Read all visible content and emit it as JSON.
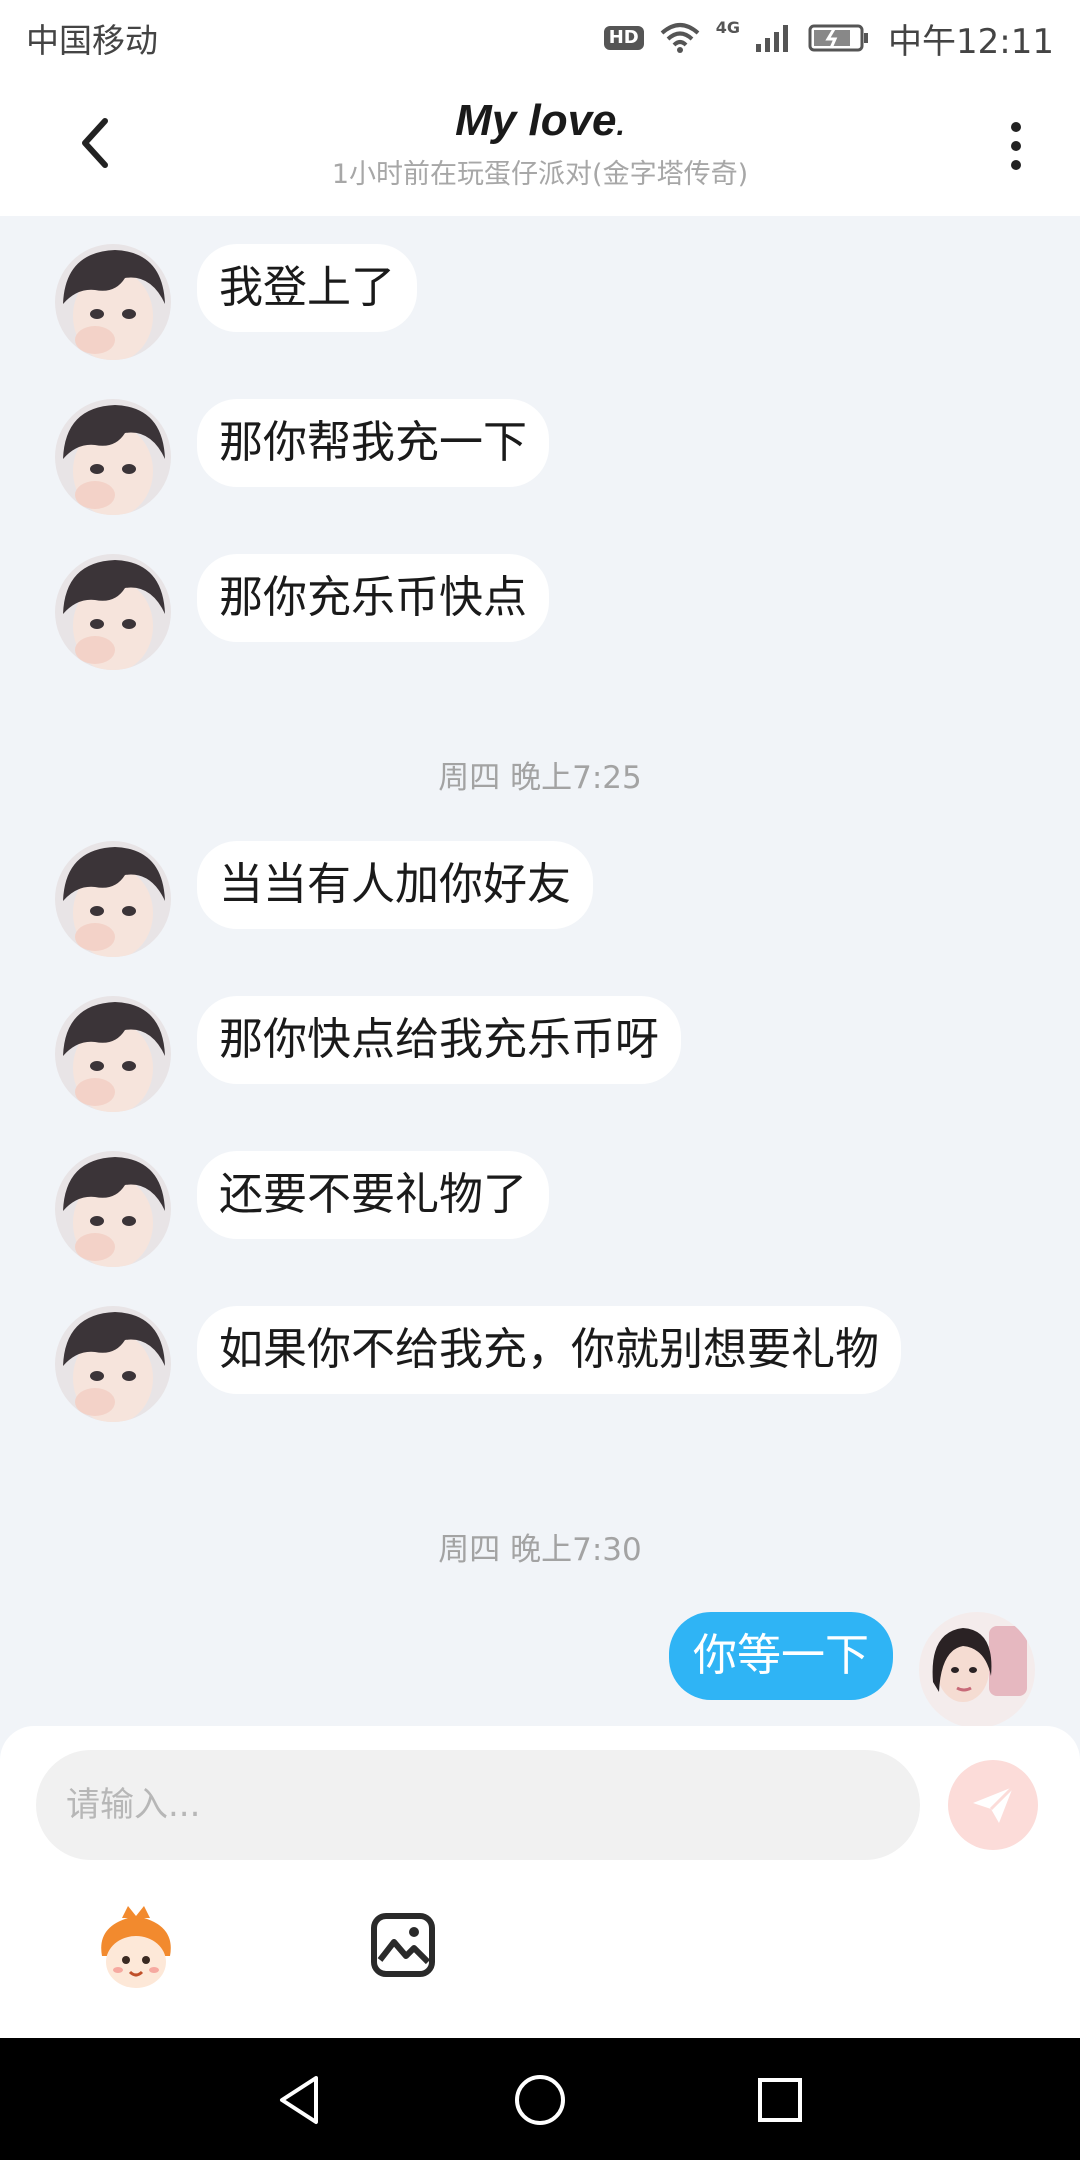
{
  "status_bar": {
    "carrier": "中国移动",
    "hd": "HD",
    "network": "4G",
    "time": "中午12:11"
  },
  "header": {
    "title": "My love",
    "title_dot": ".",
    "subtitle": "1小时前在玩蛋仔派对(金字塔传奇)"
  },
  "messages": [
    {
      "type": "incoming",
      "text": "我登上了"
    },
    {
      "type": "incoming",
      "text": "那你帮我充一下"
    },
    {
      "type": "incoming",
      "text": "那你充乐币快点"
    },
    {
      "type": "time",
      "text": "周四 晚上7:25"
    },
    {
      "type": "incoming",
      "text": "当当有人加你好友"
    },
    {
      "type": "incoming",
      "text": "那你快点给我充乐币呀"
    },
    {
      "type": "incoming",
      "text": "还要不要礼物了"
    },
    {
      "type": "incoming",
      "text": "如果你不给我充，你就别想要礼物"
    },
    {
      "type": "time",
      "text": "周四 晚上7:30"
    },
    {
      "type": "outgoing",
      "text": "你等一下"
    }
  ],
  "input": {
    "placeholder": "请输入..."
  },
  "colors": {
    "accent": "#2fb4f5",
    "send_button": "#fcdcd9",
    "background": "#f1f4f8"
  },
  "icons": [
    "back-arrow-icon",
    "more-vertical-icon",
    "send-icon",
    "mascot-icon",
    "image-icon",
    "nav-back-icon",
    "nav-home-icon",
    "nav-recents-icon"
  ]
}
